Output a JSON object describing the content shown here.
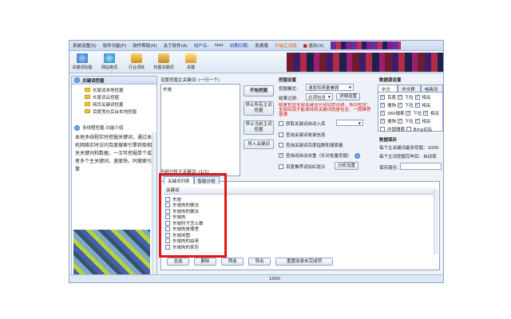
{
  "menubar": {
    "items": [
      "系统设置(S)",
      "软件功能(F)",
      "软件帮助(H)",
      "关于软件(A)"
    ],
    "username_label": "用户名:",
    "username": "test",
    "expire_label": "到期日期:",
    "expire": "免费版",
    "upgrade": "升级正式版",
    "exit": "退出(X)"
  },
  "toolbar": {
    "buttons": [
      "关键词挖掘",
      "网站爬词",
      "行业词库",
      "权重关键词",
      "关键"
    ]
  },
  "left": {
    "panel_title": "关键词挖掘",
    "tree": [
      "长尾词本地挖掘",
      "长尾词云挖掘",
      "网页关键词挖掘",
      "百度竞价后台本地挖掘"
    ],
    "section_title": "多线程挖掘-功能介绍",
    "description": "本地多线程实时挖掘关键词，通过本机网络实时访问百度搜索引擎获取相关关键词和数据，一次可挖掘单个或者多个主关键词，速度快，同搜索引擎"
  },
  "main": {
    "seed_label": "设置挖掘主关键词: (一行一个)",
    "seed_text": "东坡",
    "btn_start": "开始挖掘",
    "btn_stop_all": "停止所有主词挖掘",
    "btn_stop_current": "停止当前主词挖掘",
    "btn_import": "导入关键词",
    "current_label": "当前分析主关键词:",
    "current_count": "(1/1)"
  },
  "settings": {
    "title": "挖掘设置",
    "mode_label": "挖掘模式:",
    "mode_value": "速度和质量兼顾",
    "filter_label": "结果过滤:",
    "filter_value": "必须包含",
    "filter_btn": "详细设置",
    "warning": "结果包含全部关键词分词后的词语，按词包含：全部出现才能保持原关键词就是包含，一般推荐普通",
    "opt1": "获取关键词自动入库",
    "opt2": "查询关键词收录信息",
    "opt3": "查询关键词百度指数和搜索量",
    "opt4": "查询词自动去重（针对批量挖掘）",
    "opt5": "百度推荐词加红提示",
    "analysis_btn": "分析设置"
  },
  "datasource": {
    "title": "数据源设置",
    "tabs": [
      "中文PC",
      "中文移动",
      "电商词搭"
    ],
    "rows": [
      [
        "百度",
        "下拉",
        "相关"
      ],
      [
        "搜狗",
        "下拉",
        "相关"
      ],
      [
        "360搜索",
        "下拉",
        "相关"
      ],
      [
        "搜狗",
        "下拉",
        "相关"
      ],
      [
        "中国搜索",
        "Bing论坛"
      ]
    ]
  },
  "datasave": {
    "title": "数据保存",
    "line1": "每个主关键词最多挖掘：1000",
    "line2": "每个主词挖掘完毕后：自动保",
    "line3": "保存路径："
  },
  "results": {
    "tabs": [
      "关键词列表",
      "智能分组"
    ],
    "column": "关键词",
    "keywords": [
      "东坡",
      "东坡肉的做法",
      "东坡肉的做法",
      "东坡肉",
      "东坡肘子怎么做",
      "东坡肉是哪里",
      "东坡闲图",
      "东坡肉的由来",
      "东坡肉的来历"
    ],
    "buttons": [
      "全选",
      "删除",
      "筛选",
      "导出",
      "重置收录未完成项"
    ]
  },
  "status": {
    "count": "1000"
  }
}
